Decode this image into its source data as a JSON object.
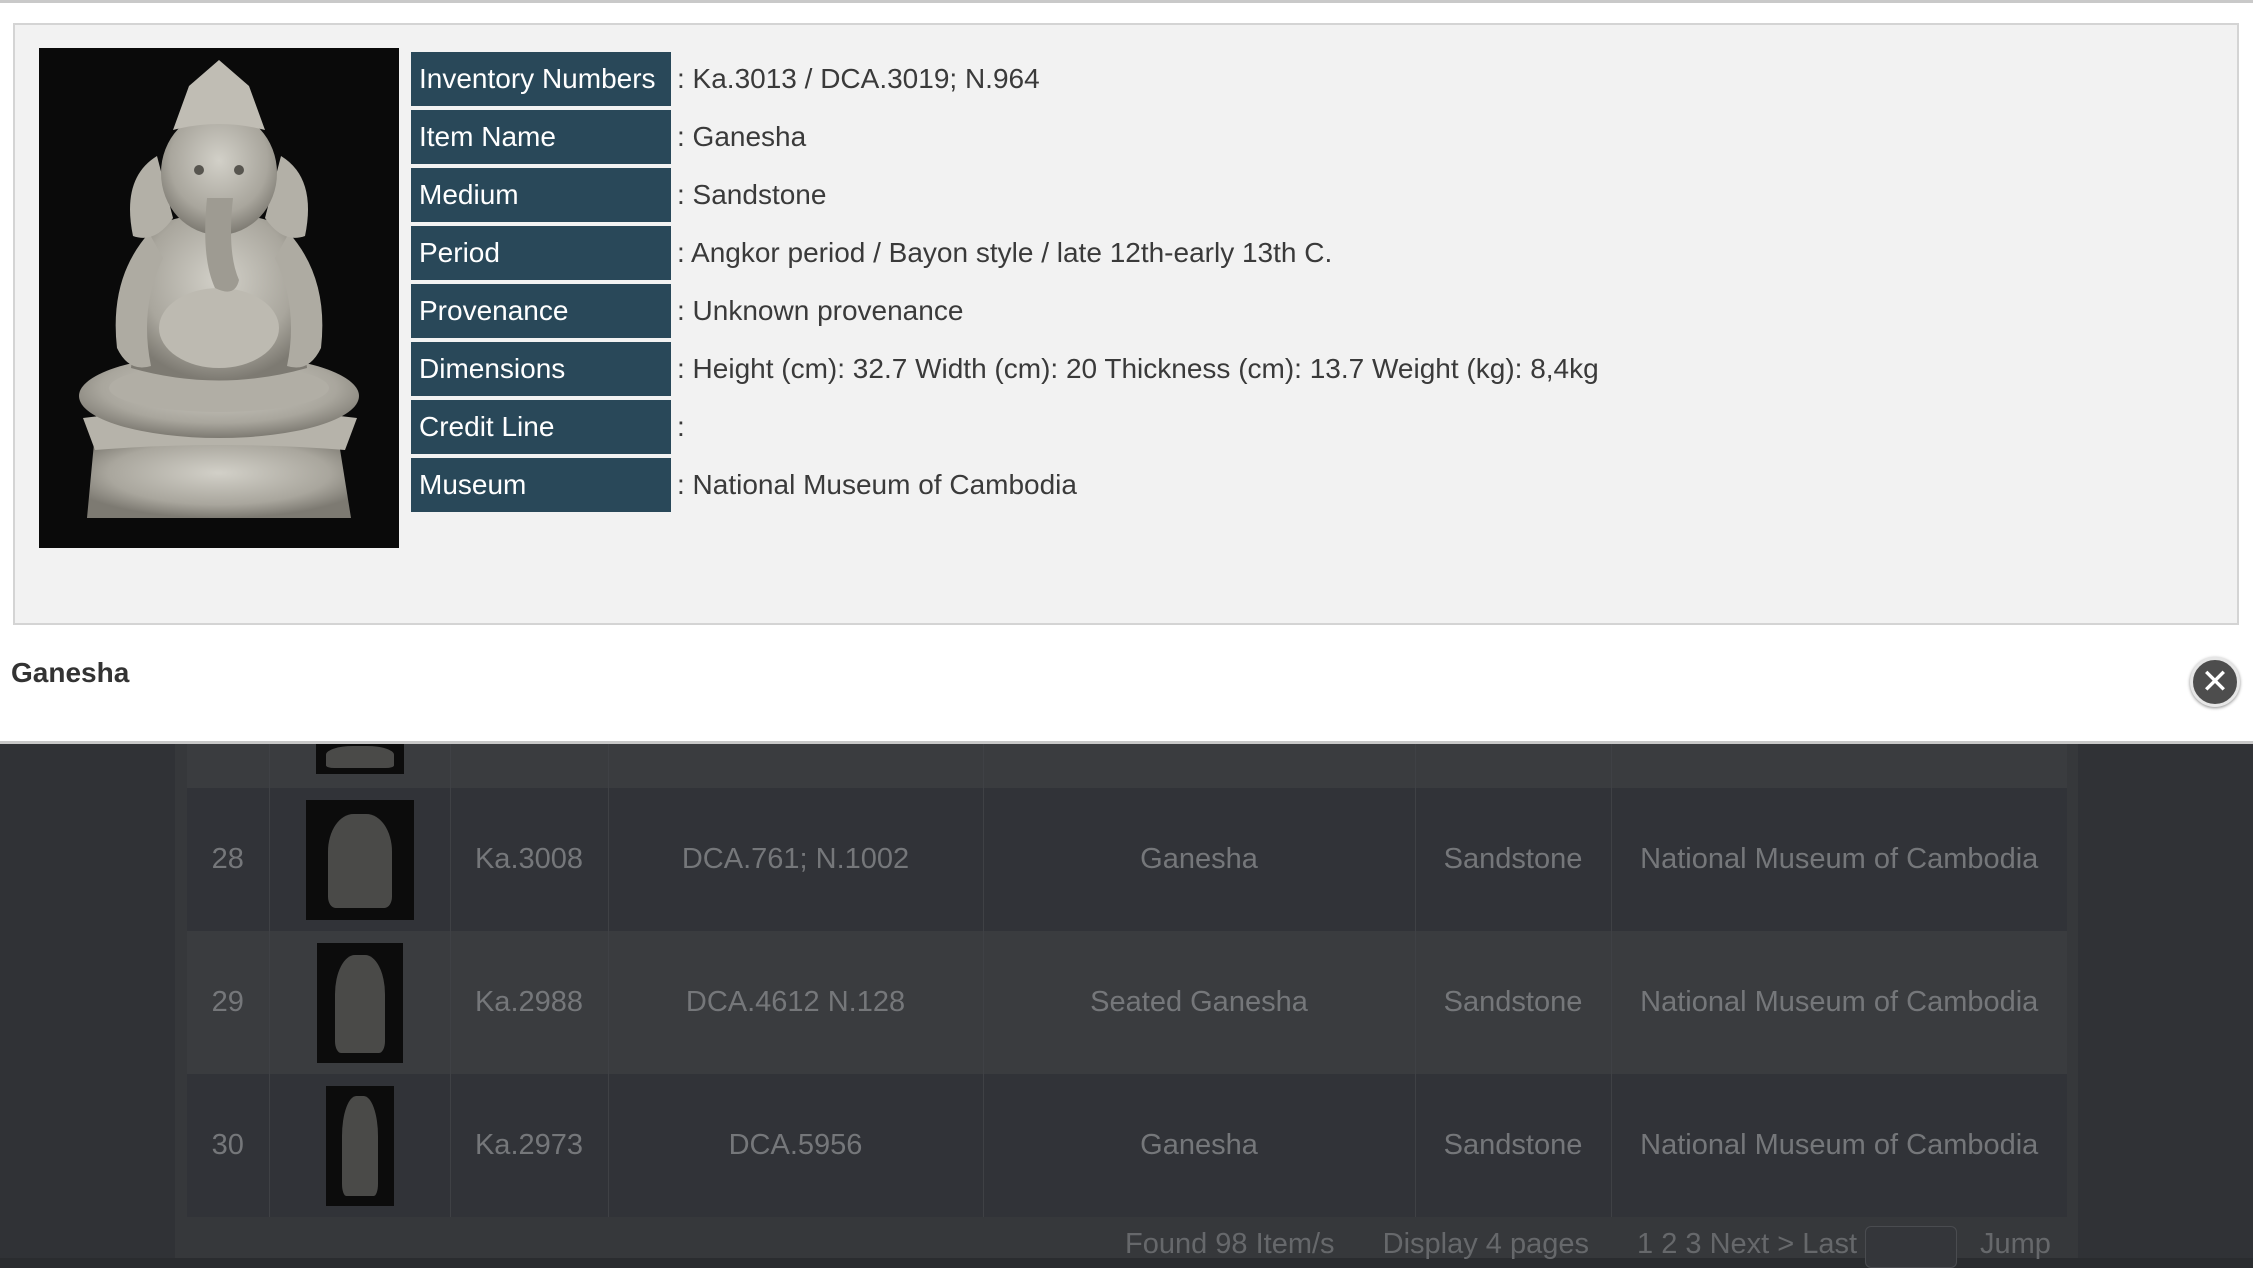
{
  "modal": {
    "title": "Ganesha",
    "close_icon": "close-icon",
    "photo_alt": "Ganesha sandstone sculpture",
    "fields": [
      {
        "label": "Inventory Numbers",
        "value": ": Ka.3013 / DCA.3019; N.964"
      },
      {
        "label": "Item Name",
        "value": ": Ganesha"
      },
      {
        "label": "Medium",
        "value": ": Sandstone"
      },
      {
        "label": "Period",
        "value": ": Angkor period / Bayon style / late 12th-early 13th C."
      },
      {
        "label": "Provenance",
        "value": ": Unknown provenance"
      },
      {
        "label": "Dimensions",
        "value": ": Height (cm): 32.7 Width (cm): 20 Thickness (cm): 13.7 Weight (kg): 8,4kg"
      },
      {
        "label": "Credit Line",
        "value": ":"
      },
      {
        "label": "Museum",
        "value": ": National Museum of Cambodia"
      }
    ]
  },
  "colors": {
    "label_bg": "#294859",
    "overlay": "#303236"
  },
  "table": {
    "rows": [
      {
        "no": "28",
        "id": "Ka.3008",
        "inv": "DCA.761; N.1002",
        "name": "Ganesha",
        "medium": "Sandstone",
        "museum": "National Museum of Cambodia"
      },
      {
        "no": "29",
        "id": "Ka.2988",
        "inv": "DCA.4612 N.128",
        "name": "Seated Ganesha",
        "medium": "Sandstone",
        "museum": "National Museum of Cambodia"
      },
      {
        "no": "30",
        "id": "Ka.2973",
        "inv": "DCA.5956",
        "name": "Ganesha",
        "medium": "Sandstone",
        "museum": "National Museum of Cambodia"
      }
    ]
  },
  "pager": {
    "found": "Found 98 Item/s",
    "display": "Display 4 pages",
    "pages": "1 2 3 Next >  Last >>",
    "jump": "Jump"
  }
}
